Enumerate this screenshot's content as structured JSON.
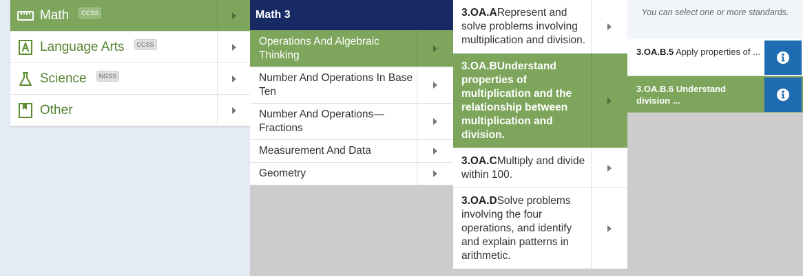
{
  "subjects": [
    {
      "label": "Math",
      "badge": "CCSS",
      "icon": "ruler-icon",
      "active": true
    },
    {
      "label": "Language Arts",
      "badge": "CCSS",
      "icon": "letter-a-icon",
      "active": false
    },
    {
      "label": "Science",
      "badge": "NGSS",
      "icon": "flask-icon",
      "active": false
    },
    {
      "label": "Other",
      "badge": "",
      "icon": "bookmark-icon",
      "active": false
    }
  ],
  "grade": {
    "title": "Math 3"
  },
  "domains": [
    {
      "label": "Operations And Algebraic Thinking",
      "active": true
    },
    {
      "label": "Number And Operations In Base Ten",
      "active": false
    },
    {
      "label": "Number And Operations—Fractions",
      "active": false
    },
    {
      "label": "Measurement And Data",
      "active": false
    },
    {
      "label": "Geometry",
      "active": false
    }
  ],
  "clusters": [
    {
      "code": "3.OA.A",
      "text": "Represent and solve problems involving multiplication and division.",
      "active": false
    },
    {
      "code": "3.OA.B",
      "text": "Understand properties of multiplication and the relationship between multiplication and division.",
      "active": true
    },
    {
      "code": "3.OA.C",
      "text": "Multiply and divide within 100.",
      "active": false
    },
    {
      "code": "3.OA.D",
      "text": "Solve problems involving the four operations, and identify and explain patterns in arithmetic.",
      "active": false
    }
  ],
  "standards_panel": {
    "hint": "You can select one or more standards.",
    "items": [
      {
        "code": "3.OA.B.5",
        "text": "Apply properties of ...",
        "active": false
      },
      {
        "code": "3.OA.B.6",
        "text": "Understand division ...",
        "active": true
      }
    ]
  },
  "colors": {
    "accent_green": "#7da55b",
    "navy": "#172a63",
    "info_blue": "#1f6cb2"
  }
}
